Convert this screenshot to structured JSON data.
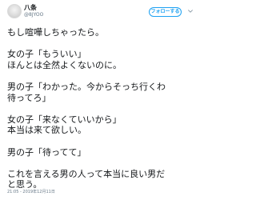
{
  "account": {
    "display_name": "八条",
    "handle": "@8JYOO"
  },
  "follow_button": {
    "label": "フォローする"
  },
  "menu_icon": "chevron-down-icon",
  "avatar_icon": "avatar",
  "colors": {
    "accent": "#1da1f2",
    "text": "#14171a",
    "muted": "#657786"
  },
  "tweet": {
    "paragraphs": [
      [
        "もし喧嘩しちゃったら。"
      ],
      [
        "女の子「もういい」",
        "ほんとは全然よくないのに。"
      ],
      [
        "男の子「わかった。今からそっち行くわ",
        "待ってろ」"
      ],
      [
        "女の子「来なくていいから」",
        "本当は来て欲しい。"
      ],
      [
        "男の子「待ってて」"
      ],
      [
        "これを言える男の人って本当に良い男だ",
        "と思う。"
      ]
    ]
  },
  "timestamp": "21:05 - 2019年12月11日"
}
